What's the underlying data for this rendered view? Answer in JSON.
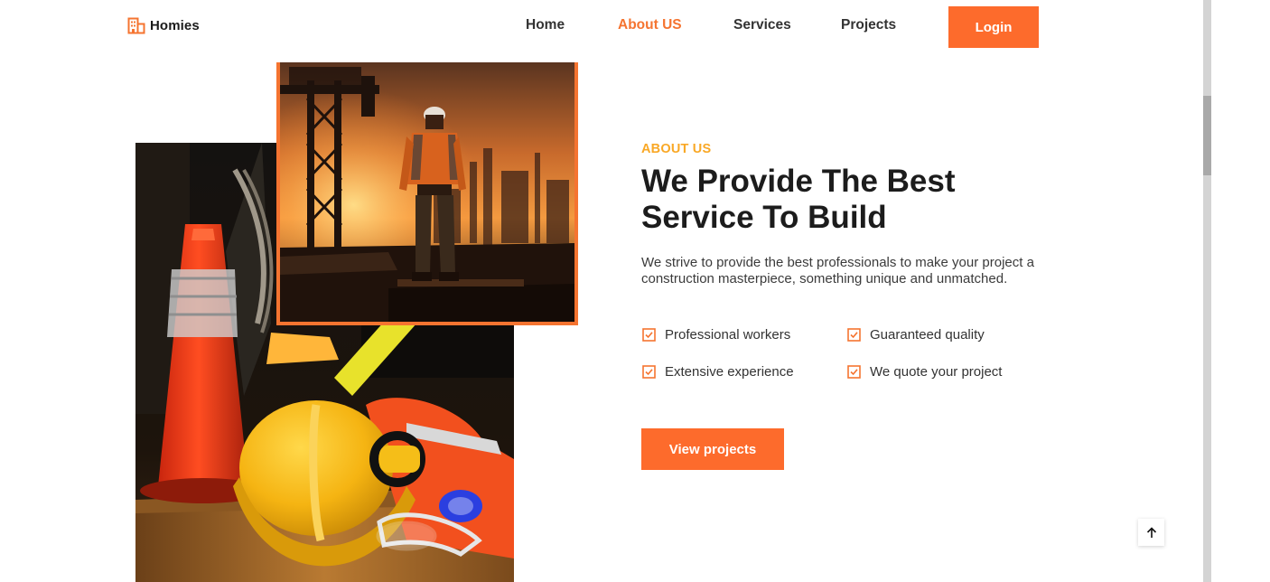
{
  "brand": {
    "name": "Homies",
    "accent": "#fd6b2c",
    "eyebrow_color": "#f9a826"
  },
  "nav": {
    "items": [
      {
        "label": "Home",
        "active": false
      },
      {
        "label": "About US",
        "active": true
      },
      {
        "label": "Services",
        "active": false
      },
      {
        "label": "Projects",
        "active": false
      }
    ],
    "login_label": "Login"
  },
  "about": {
    "eyebrow": "ABOUT US",
    "headline_line1": "We Provide The Best",
    "headline_line2": "Service To Build",
    "description": "We strive to provide the best professionals to make your project a construction masterpiece, something unique and unmatched.",
    "features": [
      "Professional workers",
      "Guaranteed quality",
      "Extensive experience",
      "We quote your project"
    ],
    "cta_label": "View projects"
  },
  "icons": {
    "logo": "building-icon",
    "feature_check": "checkbox-checked-icon",
    "back_to_top": "arrow-up-icon"
  }
}
